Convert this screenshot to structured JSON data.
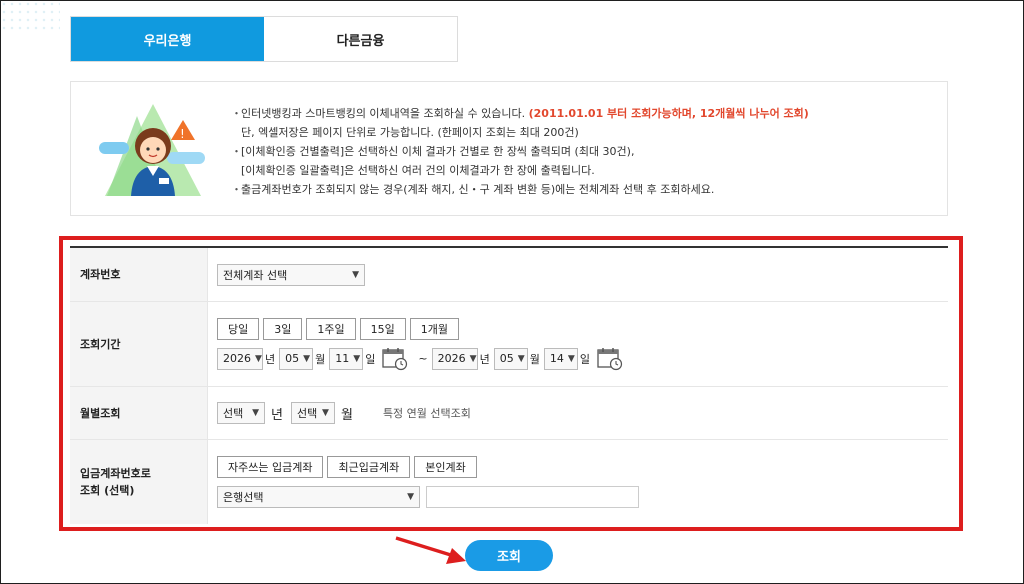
{
  "tabs": [
    {
      "label": "우리은행",
      "active": true
    },
    {
      "label": "다른금융",
      "active": false
    }
  ],
  "notes": {
    "line1": "인터넷뱅킹과 스마트뱅킹의 이체내역을 조회하실 수 있습니다.",
    "line1_red": "(2011.01.01 부터 조회가능하며, 12개월씩 나누어 조회)",
    "line2": "단, 엑셀저장은 페이지 단위로 가능합니다. (한페이지 조회는 최대 200건)",
    "line3": "[이체확인증 건별출력]은 선택하신 이체 결과가 건별로 한 장씩 출력되며 (최대 30건),",
    "line4": "[이체확인증 일괄출력]은 선택하신 여러 건의 이체결과가 한 장에 출력됩니다.",
    "line5": "출금계좌번호가 조회되지 않는 경우(계좌 해지, 신・구 계좌 변환 등)에는 전체계좌 선택 후 조회하세요."
  },
  "form": {
    "account": {
      "label": "계좌번호",
      "value": "전체계좌 선택"
    },
    "period": {
      "label": "조회기간",
      "quick": [
        "당일",
        "3일",
        "1주일",
        "15일",
        "1개월"
      ],
      "from": {
        "year": "2026",
        "month": "05",
        "day": "11"
      },
      "to": {
        "year": "2026",
        "month": "05",
        "day": "14"
      },
      "unit_year": "년",
      "unit_month": "월",
      "unit_day": "일",
      "tilde": "~"
    },
    "monthly": {
      "label": "월별조회",
      "year_value": "선택",
      "month_value": "선택",
      "unit_year": "년",
      "unit_month": "월",
      "hint": "특정 연월 선택조회"
    },
    "deposit": {
      "label_line1": "입금계좌번호로",
      "label_line2": "조회 (선택)",
      "buttons": [
        "자주쓰는 입금계좌",
        "최근입금계좌",
        "본인계좌"
      ],
      "bank_select": "은행선택",
      "account_value": ""
    }
  },
  "search_label": "조회",
  "colors": {
    "accent": "#109adf",
    "highlight_border": "#dd1e1e",
    "notice_red": "#e2482e"
  }
}
